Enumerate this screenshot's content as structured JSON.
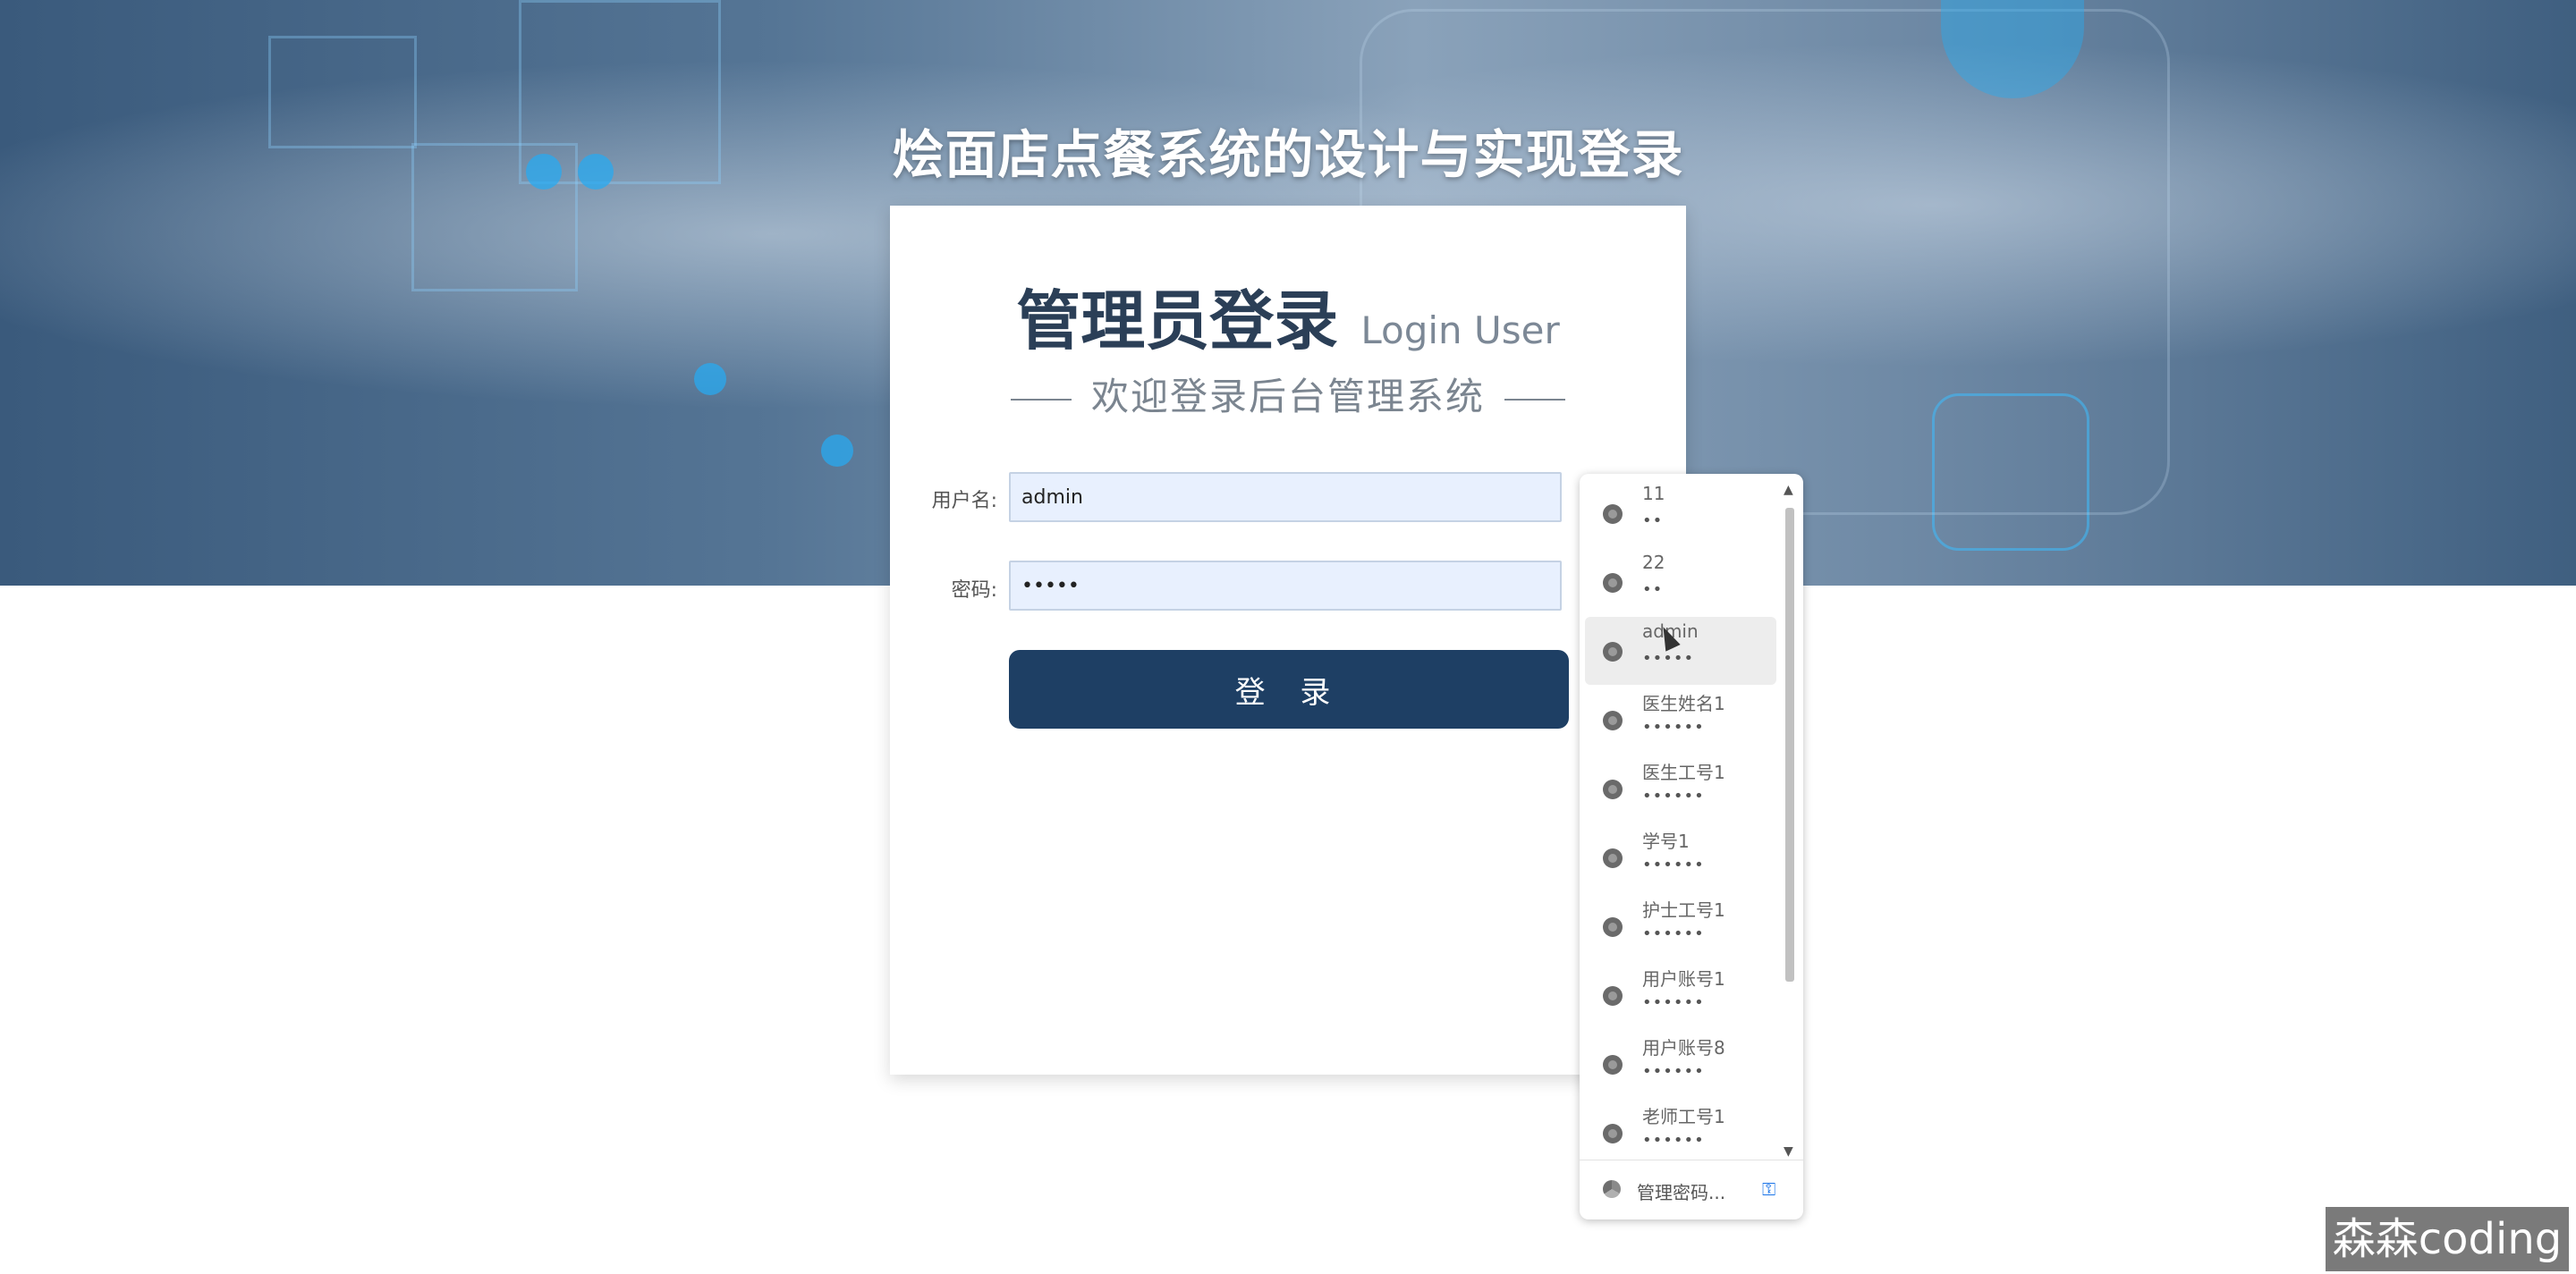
{
  "site_title": "烩面店点餐系统的设计与实现登录",
  "card": {
    "title": "管理员登录",
    "title_en": "Login User",
    "welcome": "欢迎登录后台管理系统"
  },
  "form": {
    "username_label": "用户名:",
    "username_value": "admin",
    "password_label": "密码:",
    "password_value": "•••••",
    "login_button": "登 录"
  },
  "autofill": {
    "items": [
      {
        "user": "11",
        "pass": "••"
      },
      {
        "user": "22",
        "pass": "••"
      },
      {
        "user": "admin",
        "pass": "•••••"
      },
      {
        "user": "医生姓名1",
        "pass": "••••••"
      },
      {
        "user": "医生工号1",
        "pass": "••••••"
      },
      {
        "user": "学号1",
        "pass": "••••••"
      },
      {
        "user": "护士工号1",
        "pass": "••••••"
      },
      {
        "user": "用户账号1",
        "pass": "••••••"
      },
      {
        "user": "用户账号8",
        "pass": "••••••"
      },
      {
        "user": "老师工号1",
        "pass": "••••••"
      }
    ],
    "manage_label": "管理密码..."
  },
  "watermark": "森森coding"
}
